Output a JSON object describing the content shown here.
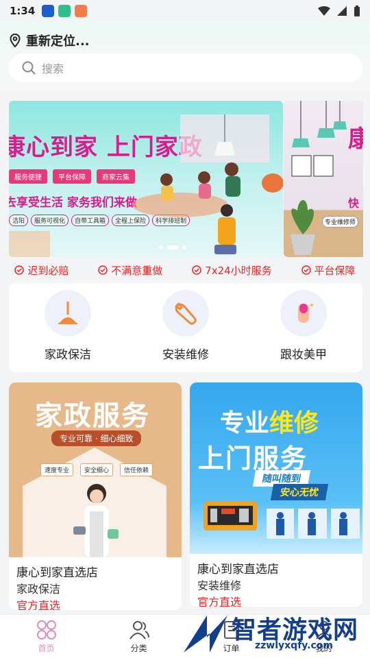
{
  "status_bar": {
    "time": "1:34"
  },
  "location": {
    "label": "重新定位..."
  },
  "search": {
    "placeholder": "搜索"
  },
  "banner": {
    "title": "康心到家 上门家政",
    "tags": [
      "服务便捷",
      "平台保障",
      "商家云集"
    ],
    "subtitle": "去享受生活 家务我们来做",
    "chips": [
      "洁阳",
      "服务可视化",
      "自带工具箱",
      "全程上保险",
      "科学排班制"
    ],
    "next_title": "康",
    "next_tag": "专业维修师",
    "next_sub": "快",
    "active_dot": 1
  },
  "guarantees": [
    "迟到必赔",
    "不满意重做",
    "7x24小时服务",
    "平台保障"
  ],
  "categories": [
    {
      "label": "家政保洁",
      "icon": "broom-icon"
    },
    {
      "label": "安装维修",
      "icon": "wrench-icon"
    },
    {
      "label": "跟妆美甲",
      "icon": "nail-icon"
    }
  ],
  "products": [
    {
      "img_title": "家政服务",
      "img_badge": "专业可靠 · 细心细致",
      "img_feats": [
        "速度专业",
        "安全细心",
        "信任依赖"
      ],
      "store": "康心到家直选店",
      "service": "家政保洁",
      "tag": "官方直选"
    },
    {
      "img_line1_a": "专业",
      "img_line1_b": "维修",
      "img_line2": "上门服务",
      "img_tag1": "随叫随到",
      "img_tag2": "安心无忧",
      "store": "康心到家直选店",
      "service": "安装维修",
      "tag": "官方直选"
    }
  ],
  "tabs": [
    {
      "label": "首页",
      "icon": "home-grid-icon",
      "active": true
    },
    {
      "label": "分类",
      "icon": "people-icon",
      "active": false
    },
    {
      "label": "订单",
      "icon": "order-icon",
      "active": false
    },
    {
      "label": "我的",
      "icon": "user-icon",
      "active": false
    }
  ],
  "watermark": {
    "text": "智者游戏网",
    "url": "zzwlyxqfy.com"
  },
  "colors": {
    "accent": "#e22222",
    "brand_pink": "#d91c8b",
    "tab_active": "#e08cb8"
  }
}
